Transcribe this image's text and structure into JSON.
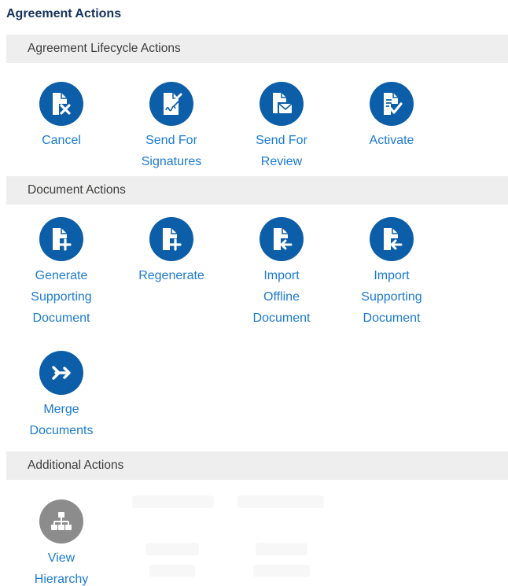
{
  "panel": {
    "title": "Agreement Actions"
  },
  "sections": {
    "lifecycle": {
      "header": "Agreement Lifecycle Actions",
      "actions": [
        {
          "label": "Cancel",
          "icon": "doc-cancel-icon"
        },
        {
          "label": "Send For\nSignatures",
          "icon": "doc-signature-icon"
        },
        {
          "label": "Send For\nReview",
          "icon": "doc-envelope-icon"
        },
        {
          "label": "Activate",
          "icon": "doc-check-icon"
        }
      ]
    },
    "document": {
      "header": "Document Actions",
      "actions": [
        {
          "label": "Generate\nSupporting\nDocument",
          "icon": "doc-plus-icon"
        },
        {
          "label": "Regenerate",
          "icon": "doc-plus-icon"
        },
        {
          "label": "Import\nOffline\nDocument",
          "icon": "doc-import-icon"
        },
        {
          "label": "Import\nSupporting\nDocument",
          "icon": "doc-import-icon"
        },
        {
          "label": "Merge\nDocuments",
          "icon": "merge-icon"
        }
      ]
    },
    "additional": {
      "header": "Additional Actions",
      "actions": [
        {
          "label": "View\nHierarchy",
          "icon": "hierarchy-icon"
        }
      ]
    }
  },
  "colors": {
    "icon_bg": "#0c5ea8",
    "icon_bg_disabled": "#8c8c8c",
    "link": "#1b7bd1",
    "header_bg": "#eeeeee",
    "title": "#16325c"
  }
}
